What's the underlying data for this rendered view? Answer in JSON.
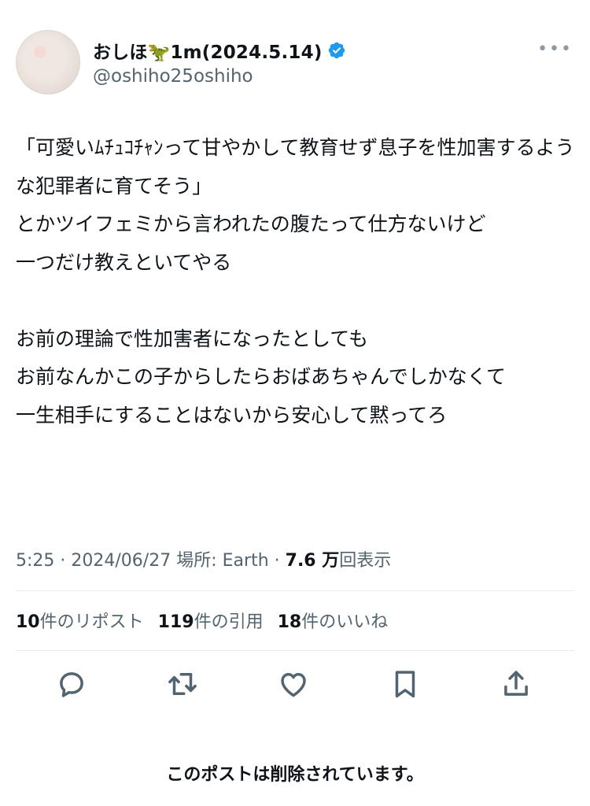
{
  "author": {
    "display_name": "おしほ🦖1m(2024.5.14)",
    "handle": "@oshiho25oshiho"
  },
  "post": {
    "text": "「可愛いﾑﾁｭｺﾁｬﾝって甘やかして教育せず息子を性加害するような犯罪者に育てそう」\nとかツイフェミから言われたの腹たって仕方ないけど\n一つだけ教えといてやる\n\nお前の理論で性加害者になったとしても\nお前なんかこの子からしたらおばあちゃんでしかなくて\n一生相手にすることはないから安心して黙ってろ",
    "time": "5:25",
    "date": "2024/06/27",
    "location_label": "場所:",
    "location": "Earth",
    "views": "7.6 万",
    "views_label": "回表示"
  },
  "stats": {
    "reposts_count": "10",
    "reposts_label": "件のリポスト",
    "quotes_count": "119",
    "quotes_label": "件の引用",
    "likes_count": "18",
    "likes_label": "件のいいね"
  },
  "actions": [
    {
      "icon": "reply-icon"
    },
    {
      "icon": "repost-icon"
    },
    {
      "icon": "like-icon"
    },
    {
      "icon": "bookmark-icon"
    },
    {
      "icon": "share-icon"
    }
  ],
  "notice": "このポストは削除されています。",
  "colors": {
    "text": "#0f1419",
    "secondary": "#536471",
    "verified": "#1d9bf0",
    "divider": "#e6ecf0"
  }
}
